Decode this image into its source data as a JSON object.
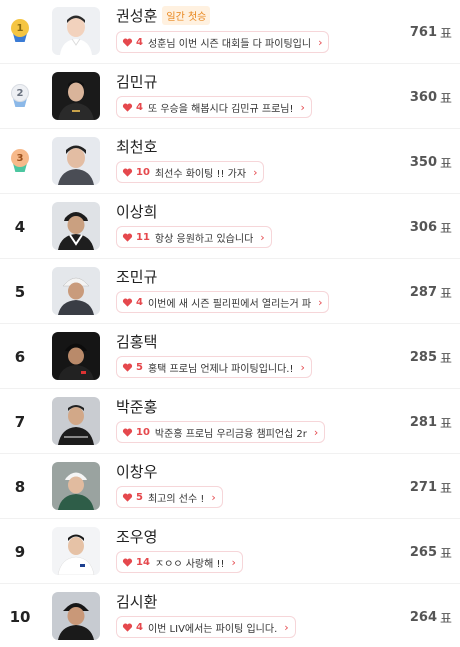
{
  "votes_unit": "표",
  "first_badge": "일간 첫승",
  "players": [
    {
      "rank": "1",
      "name": "권성훈",
      "comment_count": "4",
      "comment": "성훈님 이번 시즌 대회들 다 파이팅입니",
      "votes": "761"
    },
    {
      "rank": "2",
      "name": "김민규",
      "comment_count": "4",
      "comment": "또 우승을 해봅시다 김민규 프로님!",
      "votes": "360"
    },
    {
      "rank": "3",
      "name": "최천호",
      "comment_count": "10",
      "comment": "최선수 화이팅 !! 가자",
      "votes": "350"
    },
    {
      "rank": "4",
      "name": "이상희",
      "comment_count": "11",
      "comment": "항상 응원하고 있습니다",
      "votes": "306"
    },
    {
      "rank": "5",
      "name": "조민규",
      "comment_count": "4",
      "comment": "이번에 새 시즌 필리핀에서 열리는거 파",
      "votes": "287"
    },
    {
      "rank": "6",
      "name": "김홍택",
      "comment_count": "5",
      "comment": "홍택 프로님 언제나 파이팅입니다.!",
      "votes": "285"
    },
    {
      "rank": "7",
      "name": "박준홍",
      "comment_count": "10",
      "comment": "박준홍 프로님 우리금융 챔피언십 2r",
      "votes": "281"
    },
    {
      "rank": "8",
      "name": "이창우",
      "comment_count": "5",
      "comment": "최고의 선수 !",
      "votes": "271"
    },
    {
      "rank": "9",
      "name": "조우영",
      "comment_count": "14",
      "comment": "ㅈㅇㅇ 사랑해 !!",
      "votes": "265"
    },
    {
      "rank": "10",
      "name": "김시환",
      "comment_count": "4",
      "comment": "이번 LIV에서는 파이팅 입니다.",
      "votes": "264"
    }
  ],
  "colors": {
    "gold": "#f5c542",
    "silver": "#d9dde3",
    "bronze": "#f3a46b",
    "heart": "#e5484d",
    "badge_text": "#e8851a"
  }
}
